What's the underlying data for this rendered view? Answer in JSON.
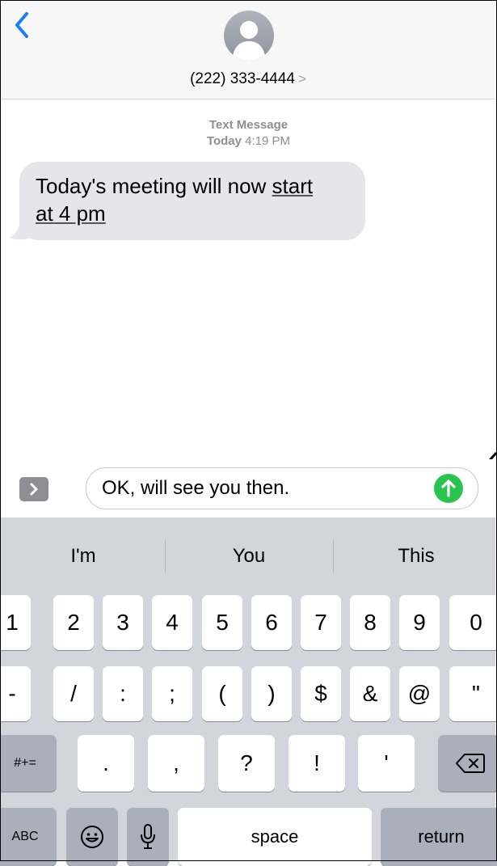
{
  "header": {
    "contact": "(222) 333-4444",
    "contact_chevron": ">"
  },
  "thread": {
    "service": "Text Message",
    "day": "Today",
    "time": "4:19 PM",
    "message_line1_pre": "Today's meeting will now ",
    "message_line1_link": "start",
    "message_line2_link": "at 4 pm"
  },
  "compose": {
    "value": "OK, will see you then."
  },
  "suggestions": [
    "I'm",
    "You",
    "This"
  ],
  "keyboard": {
    "row1": [
      "1",
      "2",
      "3",
      "4",
      "5",
      "6",
      "7",
      "8",
      "9",
      "0"
    ],
    "row2": [
      "-",
      "/",
      ":",
      ";",
      "(",
      ")",
      "$",
      "&",
      "@",
      "\""
    ],
    "row3_mode": "#+=",
    "row3": [
      ".",
      ",",
      "?",
      "!",
      "'"
    ],
    "abc": "ABC",
    "space": "space",
    "return": "return"
  },
  "colors": {
    "accent": "#147efb",
    "send": "#29c34f",
    "bubble": "#e5e5ea",
    "keyboard_bg": "#d2d5db"
  },
  "icons": [
    "back-chevron-icon",
    "contact-avatar-icon",
    "expand-apps-icon",
    "send-arrow-icon",
    "annotation-arrow-icon",
    "emoji-icon",
    "microphone-icon",
    "backspace-icon"
  ]
}
